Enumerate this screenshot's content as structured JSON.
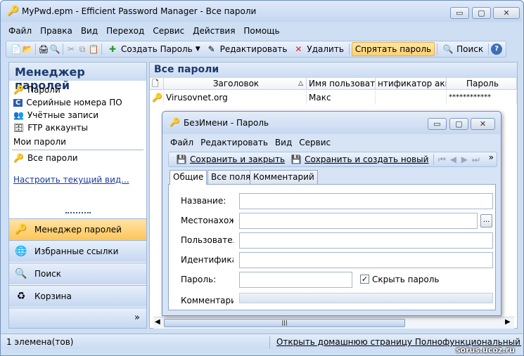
{
  "window": {
    "title": "MyPwd.epm - Efficient Password Manager - Все пароли",
    "minimize": "▭",
    "maximize": "▢",
    "close": "✕"
  },
  "menu": [
    "Файл",
    "Правка",
    "Вид",
    "Переход",
    "Сервис",
    "Действия",
    "Помощь"
  ],
  "toolbar": {
    "create": "Создать Пароль",
    "edit": "Редактировать",
    "delete": "Удалить",
    "hide_password": "Спрятать пароль",
    "search": "Поиск"
  },
  "left_panel": {
    "title": "Менеджер паролей",
    "categories": [
      "Пароли",
      "Серийные номера ПО",
      "Учётные записи",
      "FTP аккаунты"
    ],
    "section_title": "Мои пароли",
    "my_items": [
      "Все пароли"
    ],
    "customize_link": "Настроить текущий вид...",
    "buttons": [
      "Менеджер паролей",
      "Избранные ссылки",
      "Поиск",
      "Корзина"
    ]
  },
  "main": {
    "title": "Все пароли",
    "columns": [
      "Заголовок",
      "Имя пользовател",
      "нтификатор акка",
      "Пароль"
    ],
    "rows": [
      {
        "title": "Virusovnet.org",
        "user": "Макс",
        "id": "",
        "password": "************"
      }
    ]
  },
  "status": {
    "count": "1 элемена(тов)",
    "link": "Открыть домашнюю страницу Полнофункциональный мене",
    "watermark": "sorus.ucoz.ru"
  },
  "dialog": {
    "title": "БезИмени - Пароль",
    "menu": [
      "Файл",
      "Редактировать",
      "Вид",
      "Сервис"
    ],
    "save_close": "Сохранить и закрыть",
    "save_new": "Сохранить и создать новый",
    "tabs": [
      "Общие",
      "Все поля",
      "Комментарий"
    ],
    "fields": {
      "name": "Название:",
      "location": "Местонахожд",
      "user": "Пользователь",
      "identifier": "Идентификато",
      "password": "Пароль:",
      "comment": "Комментарий:"
    },
    "hide_password_label": "Скрыть пароль",
    "hide_password_checked": true,
    "browse": "..."
  },
  "colors": {
    "accent": "#1c3a6e",
    "selection": "#ffc658",
    "frame": "#cfdff3"
  }
}
